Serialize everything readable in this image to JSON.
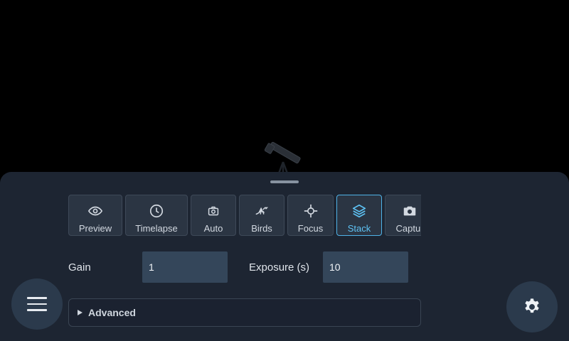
{
  "modes": [
    {
      "label": "Preview",
      "icon": "eye-icon",
      "active": false
    },
    {
      "label": "Timelapse",
      "icon": "clock-icon",
      "active": false
    },
    {
      "label": "Auto",
      "icon": "camera-small-icon",
      "active": false
    },
    {
      "label": "Birds",
      "icon": "bird-icon",
      "active": false
    },
    {
      "label": "Focus",
      "icon": "crosshair-icon",
      "active": false
    },
    {
      "label": "Stack",
      "icon": "layers-icon",
      "active": true
    },
    {
      "label": "Captur",
      "icon": "camera-icon",
      "active": false
    }
  ],
  "settings": {
    "gain": {
      "label": "Gain",
      "value": "1"
    },
    "exposure": {
      "label": "Exposure (s)",
      "value": "10"
    }
  },
  "advanced": {
    "label": "Advanced",
    "expanded": false
  },
  "buttons": {
    "menu_icon": "hamburger-icon",
    "settings_icon": "gear-icon"
  },
  "colors": {
    "accent": "#4fb3e8",
    "sheet": "#1d2532",
    "input": "#34465a"
  }
}
